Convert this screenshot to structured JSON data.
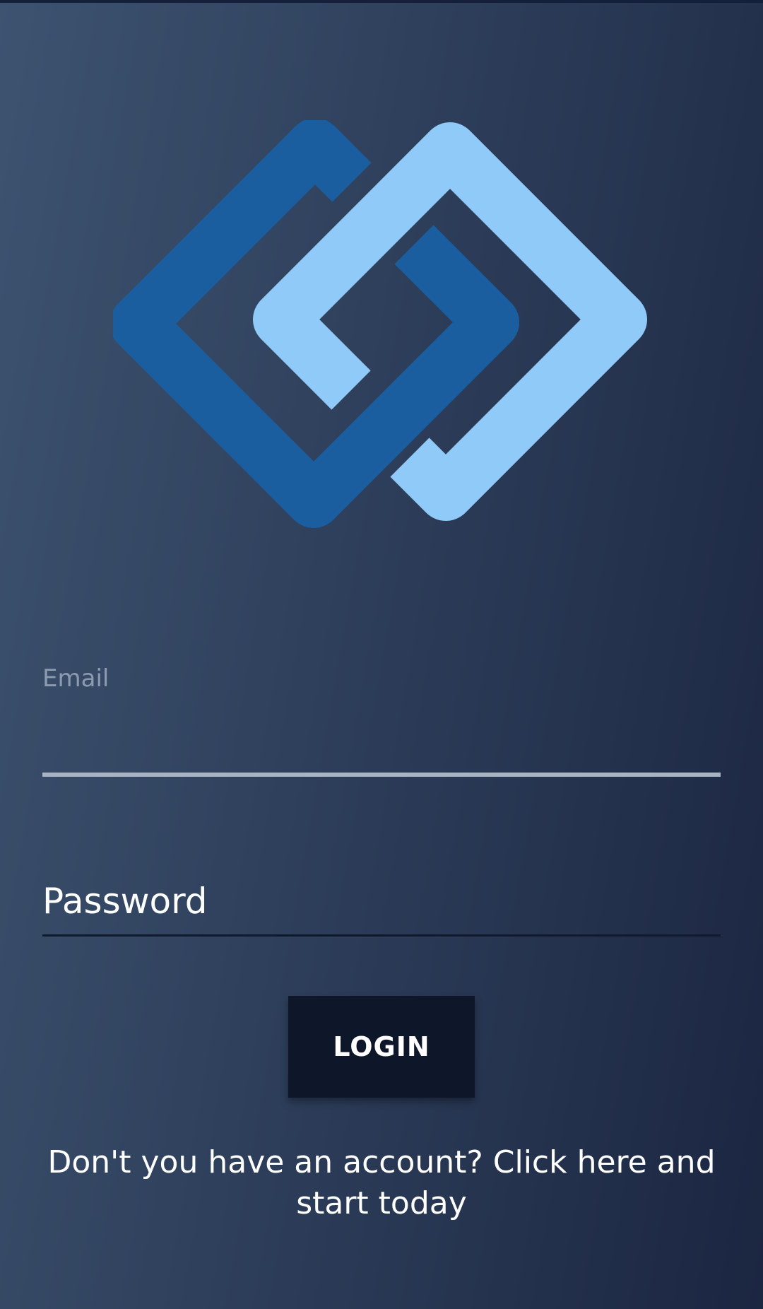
{
  "login": {
    "email_label": "Email",
    "email_value": "",
    "password_placeholder": "Password",
    "login_label": "LOGIN",
    "signup_text": "Don't you have an account? Click here and start today"
  },
  "colors": {
    "dark_blue": "#1a5e9f",
    "light_blue": "#90caf9",
    "button": "#0e172a"
  },
  "logo": {
    "icon": "interlocking-diamonds-logo"
  }
}
